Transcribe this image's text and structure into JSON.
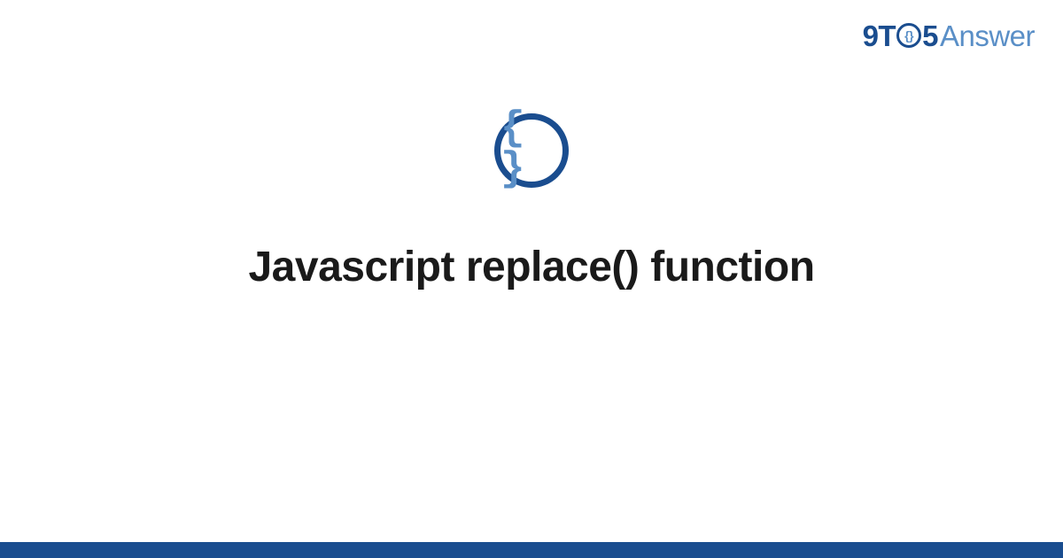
{
  "logo": {
    "part1": "9T",
    "o_inner": "{}",
    "part2": "5",
    "part3": "Answer"
  },
  "icon": {
    "name": "code-braces-icon",
    "glyph": "{ }"
  },
  "title": "Javascript replace() function",
  "colors": {
    "primary": "#1a4d8f",
    "secondary": "#5a8fc7",
    "text": "#1a1a1a"
  }
}
